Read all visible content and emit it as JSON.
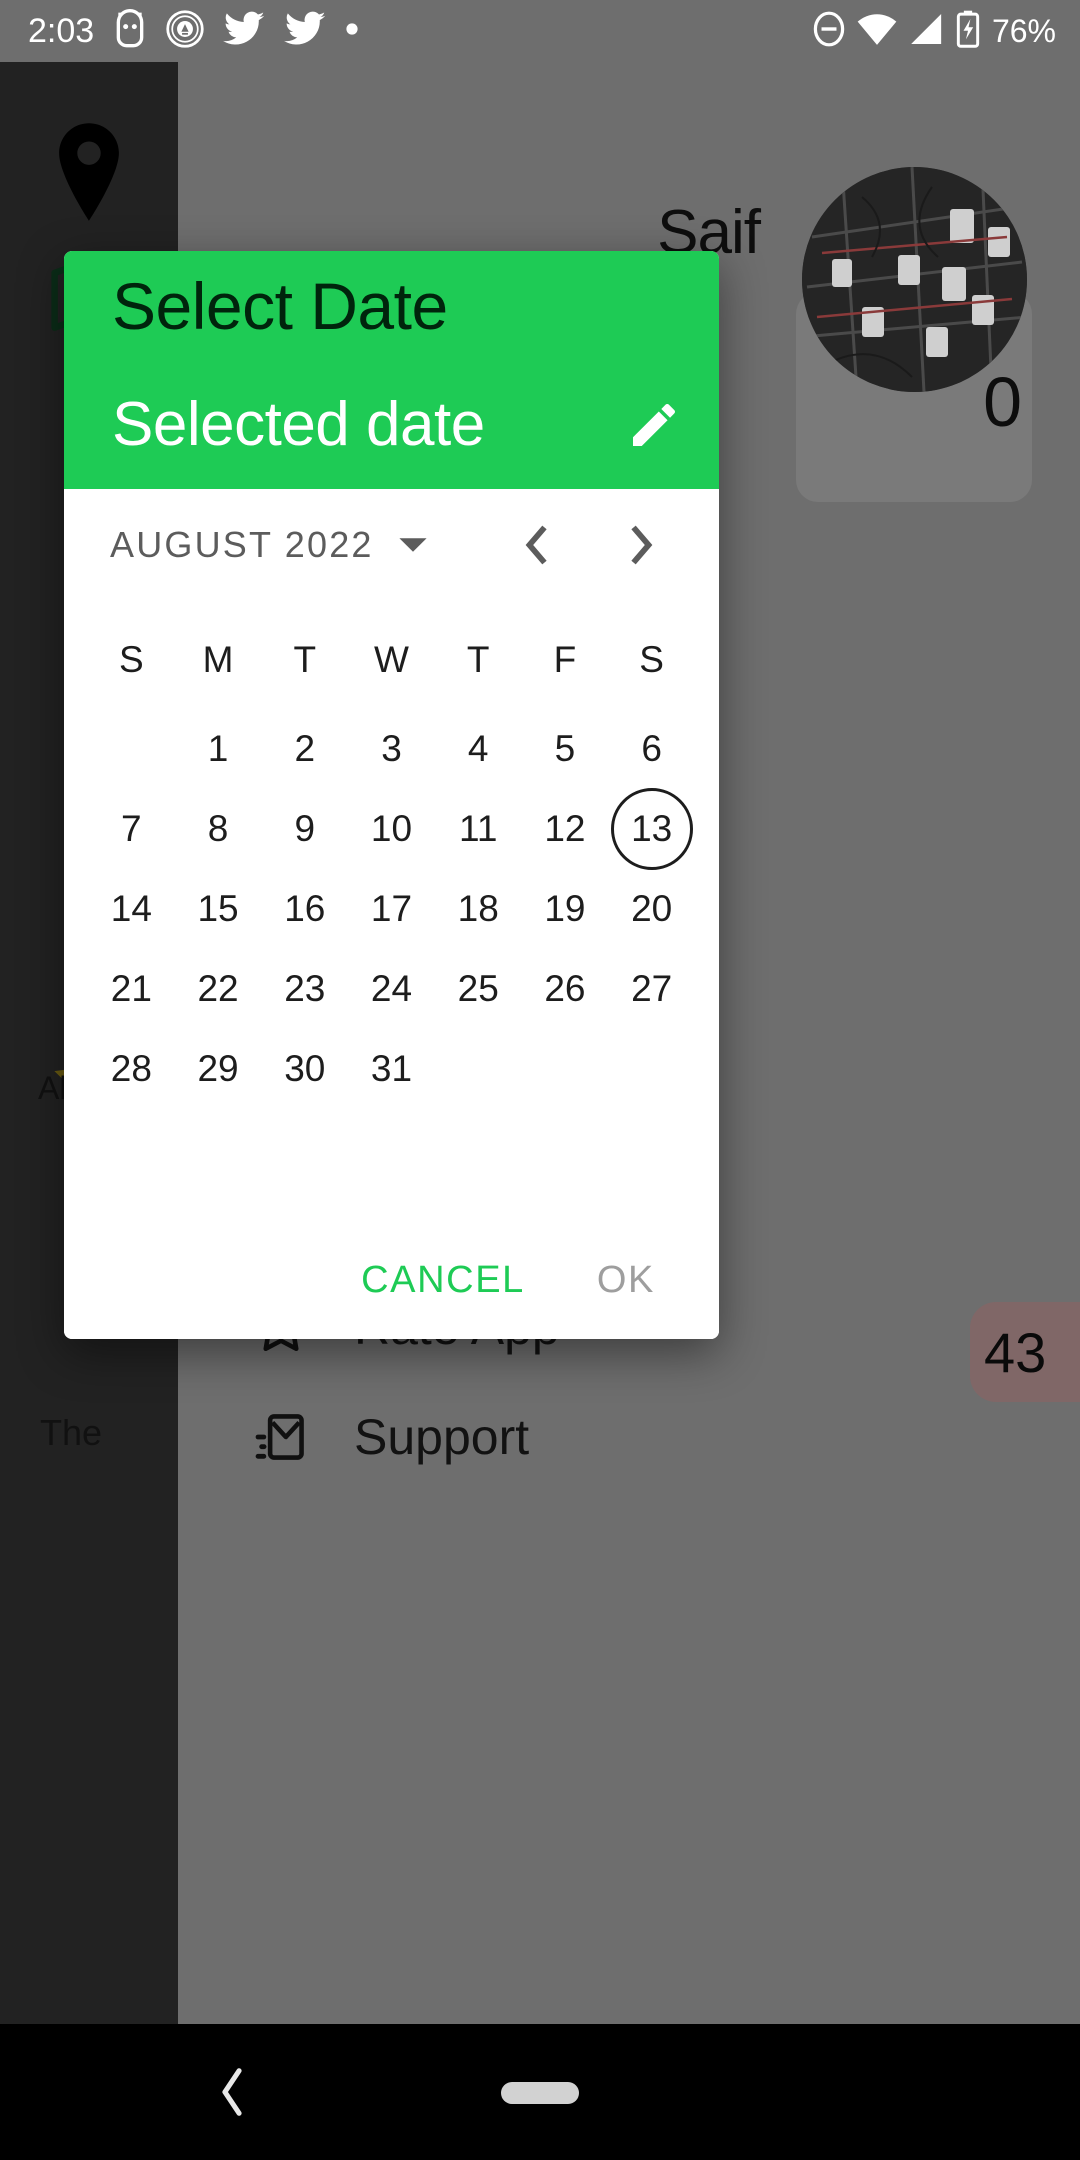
{
  "status_bar": {
    "time": "2:03",
    "battery_percent": "76%",
    "icons": [
      "android-head-icon",
      "bank-badge-icon",
      "twitter-bird-icon",
      "twitter-bird-icon",
      "dot-icon"
    ],
    "right_icons": [
      "do-not-disturb-icon",
      "wifi-icon",
      "cellular-signal-icon",
      "battery-charging-icon"
    ]
  },
  "background_app": {
    "user_name": "Saif",
    "big_number": "0",
    "badge_count": "43",
    "all_services_label": "All S",
    "the_text": "The",
    "menu_items": [
      {
        "icon": "star-icon",
        "label": "Rate App"
      },
      {
        "icon": "email-icon",
        "label": "Support"
      }
    ],
    "drawer_icons": [
      "location-pin-icon",
      "map-icon",
      "star-icon"
    ]
  },
  "dialog": {
    "title": "Select Date",
    "selected_date_text": "Selected date",
    "edit_icon": "pencil-icon",
    "month_label": "AUGUST 2022",
    "dropdown_icon": "chevron-down-icon",
    "prev_icon": "chevron-left-icon",
    "next_icon": "chevron-right-icon",
    "weekdays": [
      "S",
      "M",
      "T",
      "W",
      "T",
      "F",
      "S"
    ],
    "leading_blanks": 1,
    "days": [
      1,
      2,
      3,
      4,
      5,
      6,
      7,
      8,
      9,
      10,
      11,
      12,
      13,
      14,
      15,
      16,
      17,
      18,
      19,
      20,
      21,
      22,
      23,
      24,
      25,
      26,
      27,
      28,
      29,
      30,
      31
    ],
    "today": 13,
    "selected_day": null,
    "cancel_label": "CANCEL",
    "ok_label": "OK",
    "ok_enabled": false,
    "accent_color": "#1ECB55",
    "header_title_color": "#00240C",
    "ok_disabled_color": "#9E9E9E"
  },
  "nav_bar": {
    "back_icon": "chevron-left-icon",
    "home_icon": "home-pill-icon"
  }
}
